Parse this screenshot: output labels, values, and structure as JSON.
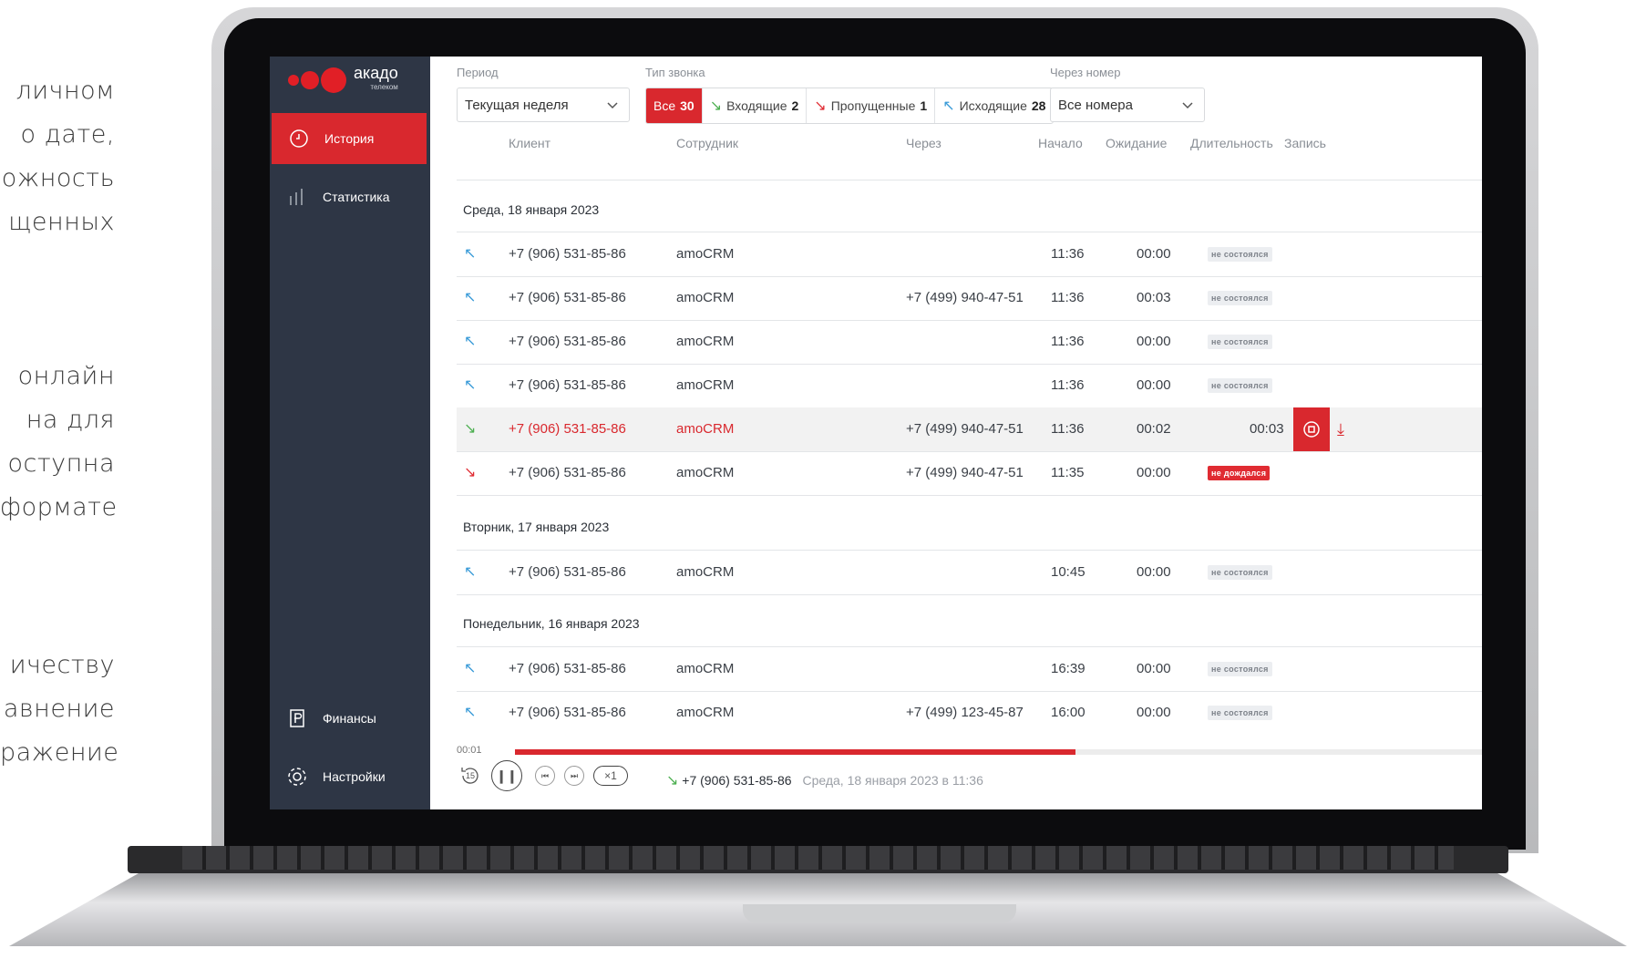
{
  "side_text": {
    "group1": [
      "личном",
      "о  дате,",
      "ожность",
      "щенных"
    ],
    "group2": [
      "онлайн",
      "на     для",
      "оступна",
      "формате"
    ],
    "group3": [
      "ичеству",
      "авнение",
      "ражение"
    ]
  },
  "app": {
    "logo": {
      "brand": "акадо",
      "sub": "телеком",
      "color": "#e11f26"
    },
    "accent": "#d9282e",
    "sidebar": {
      "items": [
        {
          "label": "История",
          "icon": "clock-icon"
        },
        {
          "label": "Статистика",
          "icon": "bar-chart-icon"
        },
        {
          "label": "Финансы",
          "icon": "ruble-doc-icon"
        },
        {
          "label": "Настройки",
          "icon": "gear-icon"
        }
      ]
    },
    "filters": {
      "period_label": "Период",
      "period_value": "Текущая неделя",
      "type_label": "Тип звонка",
      "types": [
        {
          "label": "Все",
          "count": "30"
        },
        {
          "label": "Входящие",
          "count": "2"
        },
        {
          "label": "Пропущенные",
          "count": "1"
        },
        {
          "label": "Исходящие",
          "count": "28"
        }
      ],
      "via_label": "Через номер",
      "via_value": "Все номера"
    },
    "columns": [
      "Клиент",
      "Сотрудник",
      "Через",
      "Начало",
      "Ожидание",
      "Длительность",
      "Запись"
    ],
    "groups": [
      {
        "date": "Среда, 18 января 2023",
        "rows": [
          {
            "type": "out",
            "client": "+7 (906) 531-85-86",
            "employee": "amoCRM",
            "via": "",
            "start": "11:36",
            "wait": "00:00",
            "status": "не состоялся"
          },
          {
            "type": "out",
            "client": "+7 (906) 531-85-86",
            "employee": "amoCRM",
            "via": "+7 (499) 940-47-51",
            "start": "11:36",
            "wait": "00:03",
            "status": "не состоялся"
          },
          {
            "type": "out",
            "client": "+7 (906) 531-85-86",
            "employee": "amoCRM",
            "via": "",
            "start": "11:36",
            "wait": "00:00",
            "status": "не состоялся"
          },
          {
            "type": "out",
            "client": "+7 (906) 531-85-86",
            "employee": "amoCRM",
            "via": "",
            "start": "11:36",
            "wait": "00:00",
            "status": "не состоялся"
          },
          {
            "type": "in",
            "client": "+7 (906) 531-85-86",
            "employee": "amoCRM",
            "via": "+7 (499) 940-47-51",
            "start": "11:36",
            "wait": "00:02",
            "duration": "00:03"
          },
          {
            "type": "missed",
            "client": "+7 (906) 531-85-86",
            "employee": "amoCRM",
            "via": "+7 (499) 940-47-51",
            "start": "11:35",
            "wait": "00:00",
            "status": "не дождался"
          }
        ]
      },
      {
        "date": "Вторник, 17 января 2023",
        "rows": [
          {
            "type": "out",
            "client": "+7 (906) 531-85-86",
            "employee": "amoCRM",
            "via": "",
            "start": "10:45",
            "wait": "00:00",
            "status": "не состоялся"
          }
        ]
      },
      {
        "date": "Понедельник, 16 января 2023",
        "rows": [
          {
            "type": "out",
            "client": "+7 (906) 531-85-86",
            "employee": "amoCRM",
            "via": "",
            "start": "16:39",
            "wait": "00:00",
            "status": "не состоялся"
          },
          {
            "type": "out",
            "client": "+7 (906) 531-85-86",
            "employee": "amoCRM",
            "via": "+7 (499) 123-45-87",
            "start": "16:00",
            "wait": "00:00",
            "status": "не состоялся"
          }
        ]
      }
    ],
    "player": {
      "elapsed": "00:01",
      "progress_fraction": 0.58,
      "rewind": "15",
      "speed": "×1",
      "number": "+7 (906) 531-85-86",
      "when": "Среда, 18 января 2023 в 11:36"
    }
  }
}
